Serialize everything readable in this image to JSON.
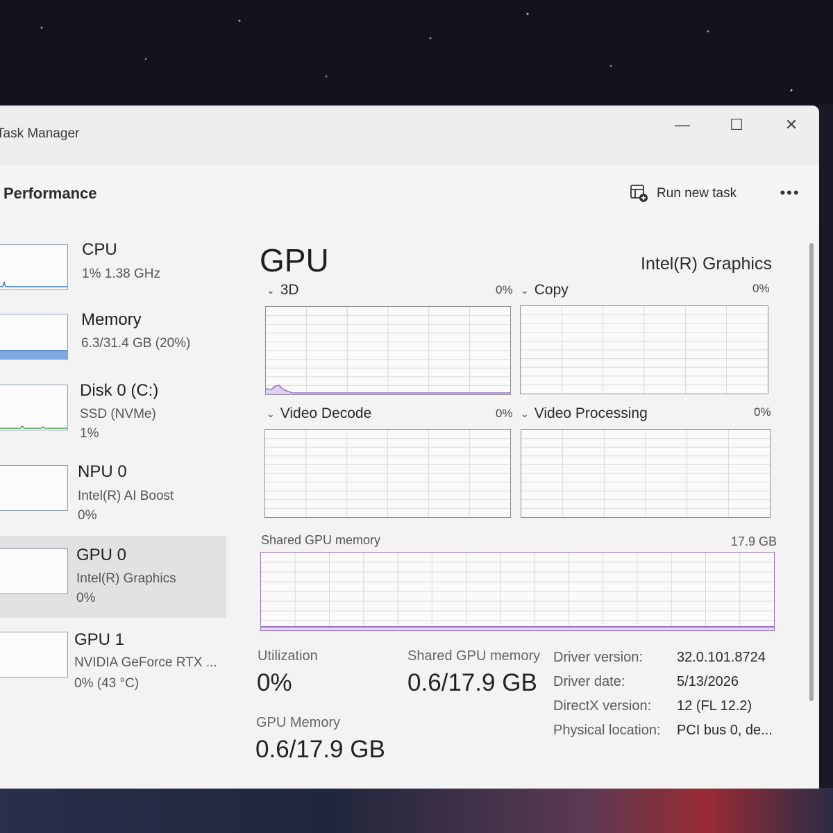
{
  "app": {
    "title": "Task Manager"
  },
  "window_controls": {
    "minimize": "—",
    "maximize": "☐",
    "close": "✕"
  },
  "header": {
    "page_title": "Performance",
    "run_new_task": "Run new task",
    "more": "•••"
  },
  "sidebar": {
    "items": [
      {
        "name": "CPU",
        "line1": "1%  1.38 GHz",
        "line2": ""
      },
      {
        "name": "Memory",
        "line1": "6.3/31.4 GB (20%)",
        "line2": ""
      },
      {
        "name": "Disk 0 (C:)",
        "line1": "SSD (NVMe)",
        "line2": "1%"
      },
      {
        "name": "NPU 0",
        "line1": "Intel(R) AI Boost",
        "line2": "0%"
      },
      {
        "name": "GPU 0",
        "line1": "Intel(R) Graphics",
        "line2": "0%"
      },
      {
        "name": "GPU 1",
        "line1": "NVIDIA GeForce RTX ...",
        "line2": "0%  (43 °C)"
      }
    ],
    "selected": "GPU 0"
  },
  "main": {
    "title": "GPU",
    "model": "Intel(R) Graphics",
    "engines": [
      {
        "name": "3D",
        "percent": "0%"
      },
      {
        "name": "Copy",
        "percent": "0%"
      },
      {
        "name": "Video Decode",
        "percent": "0%"
      },
      {
        "name": "Video Processing",
        "percent": "0%"
      }
    ],
    "shared_memory": {
      "label": "Shared GPU memory",
      "max": "17.9 GB"
    },
    "stats": {
      "utilization_label": "Utilization",
      "utilization_value": "0%",
      "shared_label": "Shared GPU memory",
      "shared_value": "0.6/17.9 GB",
      "gpu_memory_label": "GPU Memory",
      "gpu_memory_value": "0.6/17.9 GB"
    },
    "info": [
      {
        "label": "Driver version:",
        "value": "32.0.101.8724"
      },
      {
        "label": "Driver date:",
        "value": "5/13/2026"
      },
      {
        "label": "DirectX version:",
        "value": "12 (FL 12.2)"
      },
      {
        "label": "Physical location:",
        "value": "PCI bus 0, de..."
      }
    ]
  },
  "colors": {
    "gpu_line": "#9b6fc9",
    "memory_fill": "#5b8ed6",
    "window_bg": "#f3f3f3"
  },
  "icons": {
    "run_task": "run-task-icon",
    "chevron": "chevron-down-icon"
  }
}
